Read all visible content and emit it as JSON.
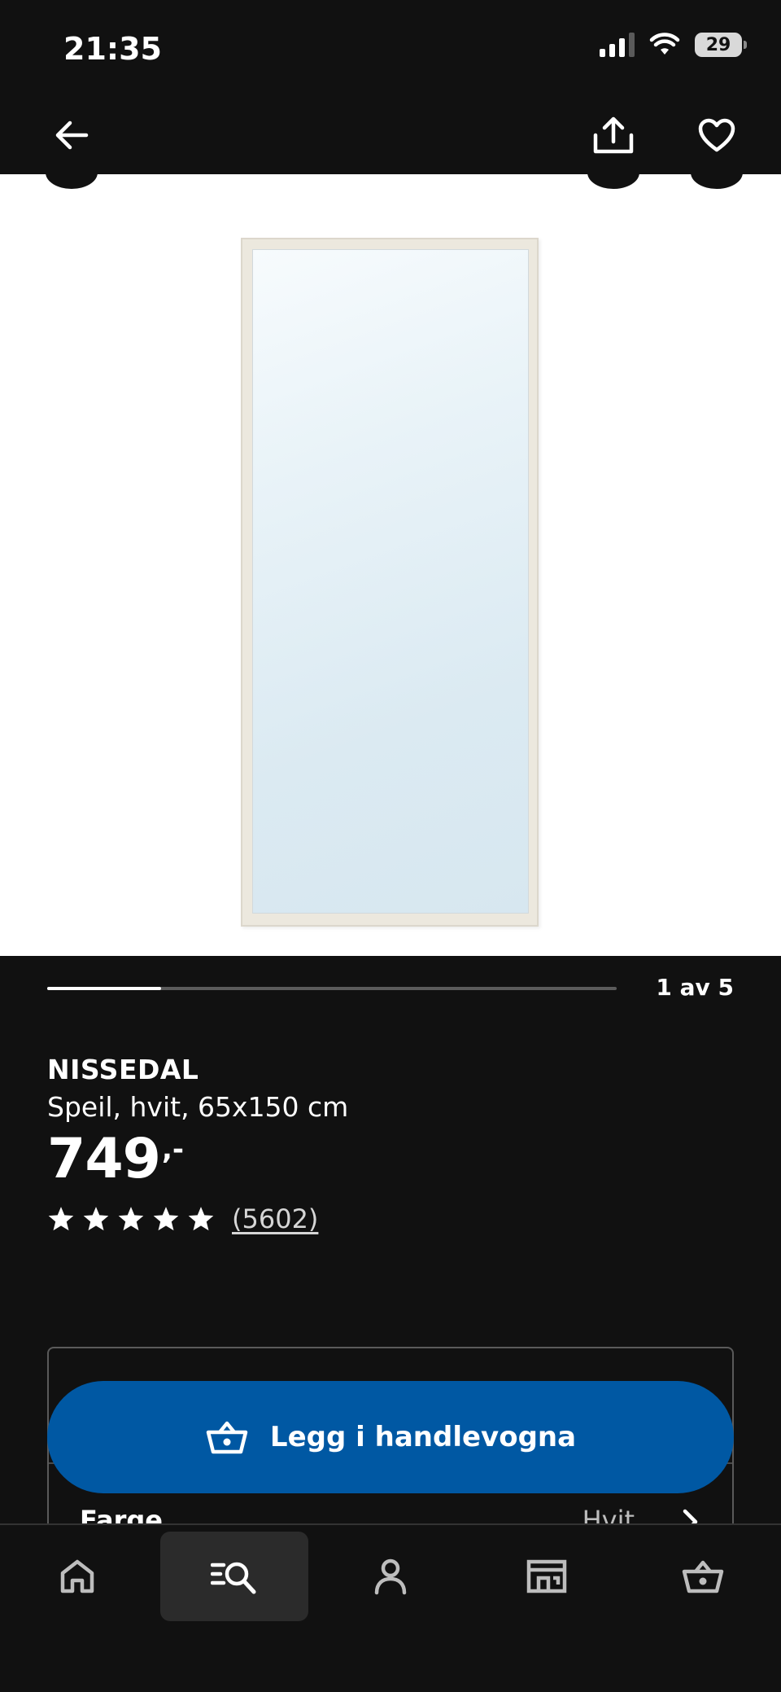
{
  "status_bar": {
    "time": "21:35",
    "battery": "29",
    "icons": [
      "signal-icon",
      "wifi-icon",
      "battery-icon"
    ]
  },
  "nav": {
    "back_icon": "arrow-left-icon",
    "share_icon": "share-icon",
    "favorite_icon": "heart-icon"
  },
  "gallery": {
    "pager_label": "1 av 5",
    "current": 1,
    "total": 5
  },
  "product": {
    "name": "NISSEDAL",
    "description": "Speil, hvit, 65x150 cm",
    "price": "749",
    "price_suffix": ",-",
    "rating_stars": 5,
    "review_count": "(5602)"
  },
  "options": {
    "color_label": "Farge",
    "color_value": "Hvit"
  },
  "cart_button": {
    "label": "Legg i handlevogna",
    "icon": "basket-icon",
    "color": "#0058a3"
  },
  "tab_bar": {
    "tabs": [
      {
        "icon": "home-icon",
        "active": false
      },
      {
        "icon": "search-icon",
        "active": true
      },
      {
        "icon": "profile-icon",
        "active": false
      },
      {
        "icon": "store-icon",
        "active": false
      },
      {
        "icon": "cart-icon",
        "active": false
      }
    ]
  }
}
